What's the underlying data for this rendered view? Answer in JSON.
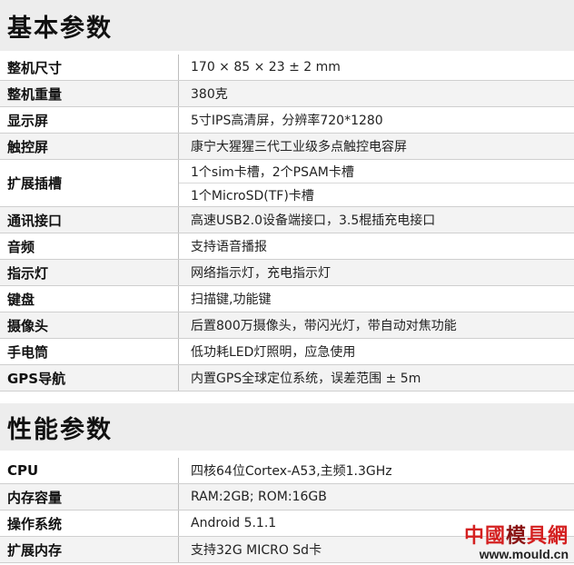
{
  "sections": {
    "basic_title": "基本参数",
    "perf_title": "性能参数"
  },
  "basic": [
    {
      "label": "整机尺寸",
      "values": [
        "170 × 85 × 23 ± 2 mm"
      ]
    },
    {
      "label": "整机重量",
      "values": [
        "380克"
      ]
    },
    {
      "label": "显示屏",
      "values": [
        "5寸IPS高清屏，分辨率720*1280"
      ]
    },
    {
      "label": "触控屏",
      "values": [
        "康宁大猩猩三代工业级多点触控电容屏"
      ]
    },
    {
      "label": "扩展插槽",
      "values": [
        "1个sim卡槽，2个PSAM卡槽",
        "1个MicroSD(TF)卡槽"
      ]
    },
    {
      "label": "通讯接口",
      "values": [
        "高速USB2.0设备端接口，3.5棍插充电接口"
      ]
    },
    {
      "label": "音频",
      "values": [
        "支持语音播报"
      ]
    },
    {
      "label": "指示灯",
      "values": [
        "网络指示灯，充电指示灯"
      ]
    },
    {
      "label": "键盘",
      "values": [
        "扫描键,功能键"
      ]
    },
    {
      "label": "摄像头",
      "values": [
        "后置800万摄像头，带闪光灯，带自动对焦功能"
      ]
    },
    {
      "label": "手电筒",
      "values": [
        "低功耗LED灯照明，应急使用"
      ]
    },
    {
      "label": "GPS导航",
      "values": [
        "内置GPS全球定位系统，误差范围 ± 5m"
      ]
    }
  ],
  "perf": [
    {
      "label": "CPU",
      "values": [
        "四核64位Cortex-A53,主频1.3GHz"
      ]
    },
    {
      "label": "内存容量",
      "values": [
        "RAM:2GB; ROM:16GB"
      ]
    },
    {
      "label": "操作系统",
      "values": [
        "Android 5.1.1"
      ]
    },
    {
      "label": "扩展内存",
      "values": [
        "支持32G MICRO Sd卡"
      ]
    }
  ],
  "watermark": {
    "brand_a": "中國",
    "brand_b": "模",
    "brand_c": "具網",
    "url": "www.mould.cn"
  }
}
